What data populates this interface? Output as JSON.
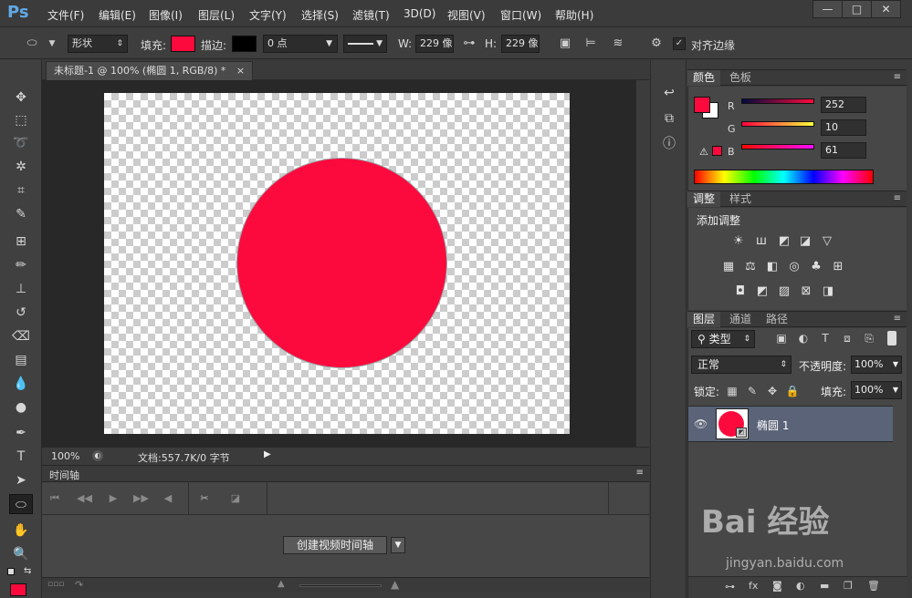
{
  "app": {
    "logo": "Ps"
  },
  "menu": [
    "文件(F)",
    "编辑(E)",
    "图像(I)",
    "图层(L)",
    "文字(Y)",
    "选择(S)",
    "滤镜(T)",
    "3D(D)",
    "视图(V)",
    "窗口(W)",
    "帮助(H)"
  ],
  "window_controls": {
    "minimize": "—",
    "maximize": "□",
    "close": "✕"
  },
  "options": {
    "mode_select": "形状",
    "fill_label": "填充:",
    "fill_color": "#fc0a3d",
    "stroke_label": "描边:",
    "stroke_color": "#000000",
    "stroke_width": "0 点",
    "width_label": "W:",
    "width_value": "229 像",
    "height_label": "H:",
    "height_value": "229 像",
    "align_edges_label": "对齐边缘"
  },
  "document": {
    "tab_title": "未标题-1 @ 100% (椭圆 1, RGB/8) *",
    "tab_close": "×",
    "zoom": "100%",
    "doc_info": "文档:557.7K/0 字节",
    "shape_color": "#fc0a3d"
  },
  "timeline": {
    "title": "时间轴",
    "create_button": "创建视频时间轴"
  },
  "color_panel": {
    "tabs": [
      "颜色",
      "色板"
    ],
    "r_label": "R",
    "r_value": "252",
    "g_label": "G",
    "g_value": "10",
    "b_label": "B",
    "b_value": "61",
    "foreground": "#fc0a3d"
  },
  "adjust_panel": {
    "tabs": [
      "调整",
      "样式"
    ],
    "title": "添加调整"
  },
  "layers_panel": {
    "tabs": [
      "图层",
      "通道",
      "路径"
    ],
    "filter_select": "类型",
    "blend_mode": "正常",
    "opacity_label": "不透明度:",
    "opacity_value": "100%",
    "lock_label": "锁定:",
    "fill_label": "填充:",
    "fill_value": "100%",
    "layers": [
      {
        "name": "椭圆 1",
        "visible": true
      }
    ]
  },
  "watermark": {
    "brand": "Bai 经验",
    "url": "jingyan.baidu.com"
  }
}
